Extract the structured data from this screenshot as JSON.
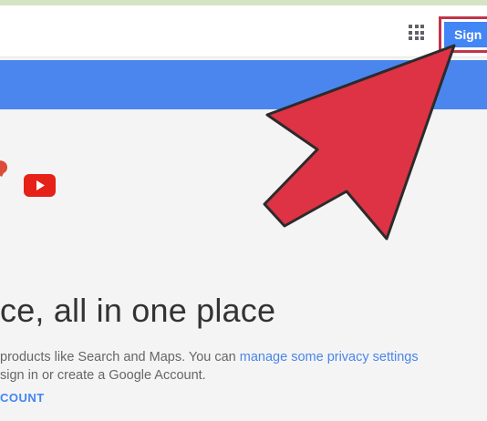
{
  "header": {
    "apps_icon": "grid-icon",
    "signin_label": "Sign"
  },
  "main": {
    "icons": [
      "google-plus-icon",
      "youtube-icon"
    ],
    "headline": "ce, all in one place",
    "desc_line1_pre": "products like Search and Maps. You can ",
    "desc_link": "manage some privacy settings",
    "desc_line2": "sign in or create a Google Account.",
    "cta_label": "COUNT"
  },
  "colors": {
    "accent_blue": "#4285f4",
    "banner_blue": "#4a86ee",
    "arrow_red": "#dd3344",
    "highlight_box": "#c0334a"
  }
}
